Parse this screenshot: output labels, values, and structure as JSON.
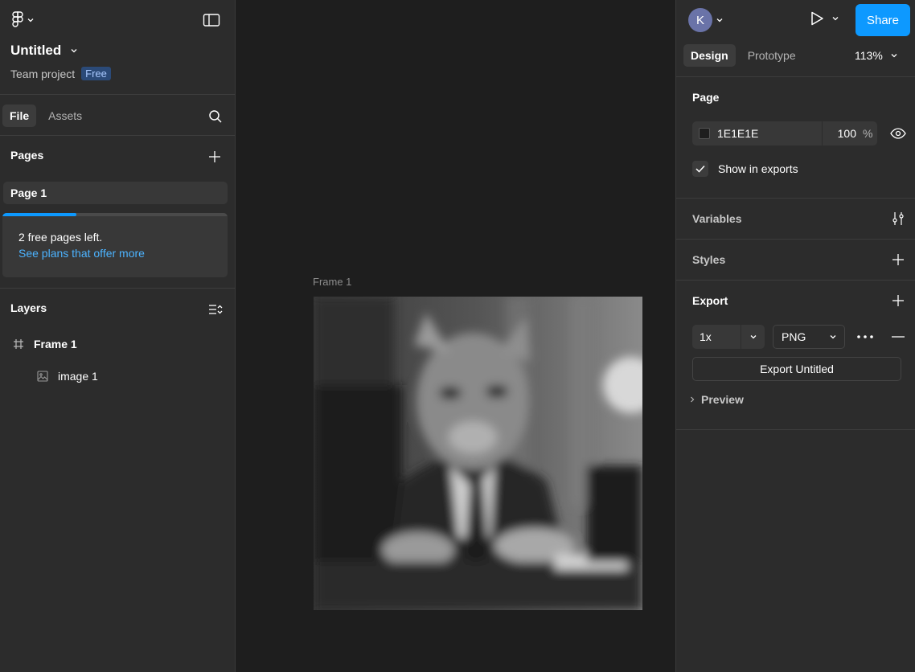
{
  "left_panel": {
    "file_title": "Untitled",
    "project_name": "Team project",
    "plan_badge": "Free",
    "tabs": [
      "File",
      "Assets"
    ],
    "pages_heading": "Pages",
    "pages": [
      "Page 1"
    ],
    "page_limit": {
      "message": "2 free pages left.",
      "link": "See plans that offer more",
      "used_fraction": 0.33
    },
    "layers_heading": "Layers",
    "layers": [
      {
        "name": "Frame 1",
        "icon": "frame-icon"
      },
      {
        "name": "image 1",
        "icon": "image-icon"
      }
    ]
  },
  "canvas": {
    "frame_label": "Frame 1",
    "background": "#1e1e1e"
  },
  "right_panel": {
    "avatar_initial": "K",
    "share_label": "Share",
    "tabs": [
      "Design",
      "Prototype"
    ],
    "zoom": "113%",
    "page_section": {
      "heading": "Page",
      "bg_hex": "1E1E1E",
      "bg_opacity": "100",
      "opacity_unit": "%",
      "show_in_exports_label": "Show in exports",
      "show_in_exports_checked": true
    },
    "variables_heading": "Variables",
    "styles_heading": "Styles",
    "export_section": {
      "heading": "Export",
      "scale": "1x",
      "format": "PNG",
      "export_button": "Export Untitled",
      "preview_label": "Preview"
    }
  },
  "colors": {
    "accent": "#0d99ff",
    "panel": "#2c2c2c",
    "canvas": "#1e1e1e",
    "link": "#4cb3ff"
  }
}
